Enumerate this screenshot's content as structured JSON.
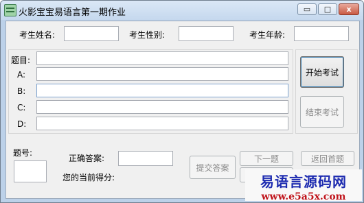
{
  "window": {
    "title": "火影宝宝易语言第一期作业",
    "min_glyph": "▭",
    "max_glyph": "□",
    "close_glyph": "x"
  },
  "student": {
    "name_label": "考生姓名:",
    "gender_label": "考生性别:",
    "age_label": "考生年龄:",
    "name_value": "",
    "gender_value": "",
    "age_value": ""
  },
  "question": {
    "title_label": "题目:",
    "option_a_label": "A:",
    "option_b_label": "B:",
    "option_c_label": "C:",
    "option_d_label": "D:"
  },
  "exam_buttons": {
    "start": "开始考试",
    "end": "结束考试"
  },
  "footer": {
    "number_label": "题号:",
    "correct_answer_label": "正确答案:",
    "score_label": "您的当前得分:",
    "submit": "提交答案",
    "next": "下一题",
    "back_first": "返回首题"
  },
  "watermark": {
    "line1": "易语言源码网",
    "line2": "www.e5a5x.com"
  },
  "colors": {
    "title_blue": "#1d2bb0",
    "url_red": "#c0141b",
    "frame": "#bcd1e9"
  }
}
